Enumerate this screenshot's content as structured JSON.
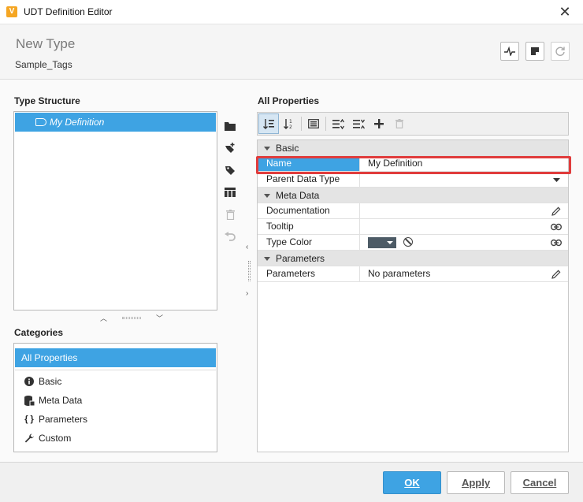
{
  "window": {
    "title": "UDT Definition Editor",
    "close_glyph": "✕",
    "app_icon": "V"
  },
  "header": {
    "title": "New Type",
    "subtitle": "Sample_Tags"
  },
  "type_structure": {
    "label": "Type Structure",
    "root_item": "My Definition"
  },
  "categories": {
    "label": "Categories",
    "selected": "All Properties",
    "items": [
      {
        "label": "Basic",
        "icon": "info-icon"
      },
      {
        "label": "Meta Data",
        "icon": "database-icon"
      },
      {
        "label": "Parameters",
        "icon": "braces-icon",
        "glyph": "{ }"
      },
      {
        "label": "Custom",
        "icon": "wrench-icon"
      }
    ]
  },
  "properties": {
    "label": "All Properties",
    "groups": [
      {
        "name": "Basic",
        "rows": [
          {
            "key": "Name",
            "value": "My Definition"
          },
          {
            "key": "Parent Data Type",
            "value": ""
          }
        ]
      },
      {
        "name": "Meta Data",
        "rows": [
          {
            "key": "Documentation",
            "value": ""
          },
          {
            "key": "Tooltip",
            "value": ""
          },
          {
            "key": "Type Color",
            "value": "",
            "color": "#4d5b66"
          }
        ]
      },
      {
        "name": "Parameters",
        "rows": [
          {
            "key": "Parameters",
            "value": "No parameters"
          }
        ]
      }
    ]
  },
  "footer": {
    "ok": "OK",
    "apply": "Apply",
    "cancel": "Cancel"
  },
  "colors": {
    "accent": "#3ea3e3",
    "highlight_border": "#e03c3c"
  }
}
